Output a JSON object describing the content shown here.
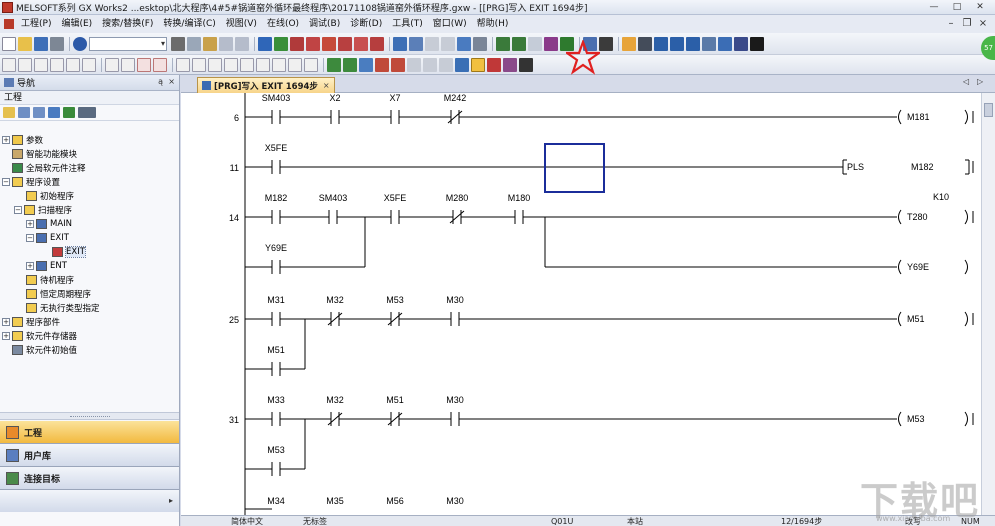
{
  "titlebar": {
    "title": "MELSOFT系列 GX Works2 ...esktop\\北大程序\\4#5#锅道窑外循环最终程序\\20171108锅道窑外循环程序.gxw - [[PRG]写入 EXIT 1694步]"
  },
  "menu": {
    "items": [
      "工程(P)",
      "编辑(E)",
      "搜索/替换(F)",
      "转换/编译(C)",
      "视图(V)",
      "在线(O)",
      "调试(B)",
      "诊断(D)",
      "工具(T)",
      "窗口(W)",
      "帮助(H)"
    ]
  },
  "nav": {
    "title": "导航",
    "pin": "ą",
    "close": "×",
    "project_label": "工程",
    "tree": [
      {
        "label": "参数"
      },
      {
        "label": "智能功能模块"
      },
      {
        "label": "全局软元件注释"
      },
      {
        "label": "程序设置"
      },
      {
        "label": "初始程序"
      },
      {
        "label": "扫描程序"
      },
      {
        "label": "MAIN"
      },
      {
        "label": "EXIT"
      },
      {
        "label": "EXIT"
      },
      {
        "label": "ENT"
      },
      {
        "label": "待机程序"
      },
      {
        "label": "恒定周期程序"
      },
      {
        "label": "无执行类型指定"
      },
      {
        "label": "程序部件"
      },
      {
        "label": "软元件存储器"
      },
      {
        "label": "软元件初始值"
      }
    ],
    "buttons": {
      "project": "工程",
      "library": "用户库",
      "connection": "连接目标"
    }
  },
  "editor": {
    "tab_label": "[PRG]写入 EXIT 1694步",
    "tab_close": "×",
    "nav_prev": "◁",
    "nav_next": "▷"
  },
  "ladder": {
    "rungs": [
      {
        "step": "6",
        "contacts": [
          "SM403",
          "X2",
          "X7",
          "M242"
        ],
        "output": "M181"
      },
      {
        "step": "11",
        "contacts": [
          "X5FE"
        ],
        "output": "M182",
        "instruction": "PLS"
      },
      {
        "step": "14",
        "contacts": [
          "M182",
          "SM403",
          "X5FE",
          "M280",
          "M180"
        ],
        "branch": "Y69E",
        "output": "T280",
        "const": "K10",
        "output2": "Y69E"
      },
      {
        "step": "25",
        "contacts": [
          "M31",
          "M32",
          "M53",
          "M30"
        ],
        "branch": "M51",
        "output": "M51"
      },
      {
        "step": "31",
        "contacts": [
          "M33",
          "M32",
          "M51",
          "M30"
        ],
        "branch": "M53",
        "output": "M53"
      },
      {
        "step": "",
        "contacts": [
          "M34",
          "M35",
          "M56",
          "M30"
        ]
      }
    ]
  },
  "status": {
    "lang": "简体中文",
    "label_mode": "无标签",
    "cpu": "Q01U",
    "station": "本站",
    "steps": "12/1694步",
    "mode": "改写",
    "num": "NUM"
  },
  "watermark": {
    "text": "下载吧",
    "sub": "www.xiazaiba.com"
  },
  "colors": {
    "accent_tab": "#f7d48a",
    "selected_nav": "#f2b940",
    "cursor_box": "#1b2d9a",
    "highlight_star": "#e02020"
  }
}
